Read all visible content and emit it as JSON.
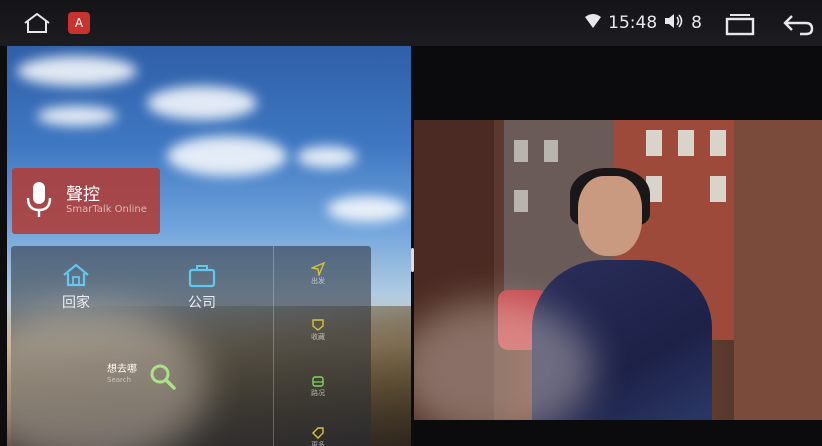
{
  "status_bar": {
    "time": "15:48",
    "volume": "8",
    "icons": [
      "home-icon",
      "app-icon",
      "wifi-icon",
      "volume-icon",
      "recents-icon",
      "back-icon"
    ],
    "app_badge": "A"
  },
  "voice_card": {
    "title": "聲控",
    "subtitle": "SmarTalk Online",
    "icon": "microphone-icon",
    "color": "#b03c37"
  },
  "nav_shortcuts": [
    {
      "label": "回家",
      "icon": "home-icon"
    },
    {
      "label": "公司",
      "icon": "briefcase-icon"
    }
  ],
  "go_where": {
    "label": "想去哪",
    "sublabel": "Search",
    "icon": "search-icon",
    "accent": "#7ed957"
  },
  "side_items": [
    {
      "label": "出发",
      "icon": "navigate-icon"
    },
    {
      "label": "收藏",
      "icon": "favorite-icon"
    },
    {
      "label": "路况",
      "icon": "car-icon"
    },
    {
      "label": "更多",
      "icon": "tag-icon"
    }
  ]
}
